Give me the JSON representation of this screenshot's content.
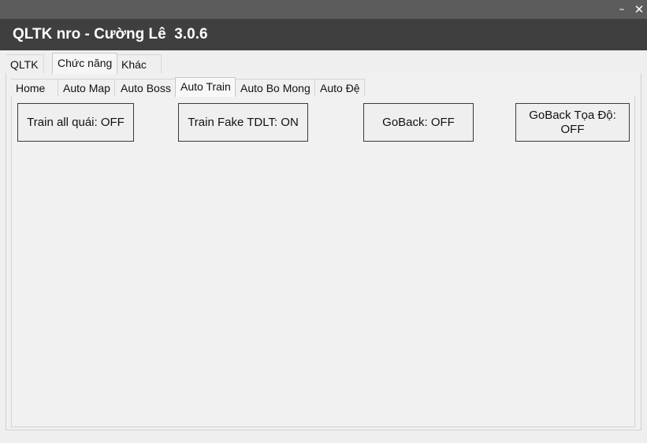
{
  "window": {
    "minimize_icon": "minimize-icon",
    "close_icon": "close-icon",
    "minimize_glyph": "–",
    "close_glyph": "✕"
  },
  "app": {
    "title": "QLTK nro - Cường Lê  3.0.6"
  },
  "outer_tabs": [
    {
      "label": "QLTK",
      "active": false
    },
    {
      "label": "Chức năng",
      "active": true
    },
    {
      "label": "Khác",
      "active": false
    }
  ],
  "inner_tabs": [
    {
      "label": "Home",
      "active": false
    },
    {
      "label": "Auto Map",
      "active": false
    },
    {
      "label": "Auto Boss",
      "active": false
    },
    {
      "label": "Auto Train",
      "active": true
    },
    {
      "label": "Auto Bo Mong",
      "active": false
    },
    {
      "label": "Auto Đệ",
      "active": false
    }
  ],
  "auto_train": {
    "train_all_label": "Train all quái: OFF",
    "train_fake_label": "Train Fake TDLT: ON",
    "goback_label": "GoBack: OFF",
    "goback_coord_label": "GoBack Tọa Độ: OFF"
  },
  "colors": {
    "titlebar": "#3f3f3f",
    "topbar": "#5c5c5c",
    "panel": "#f0f0f0"
  }
}
